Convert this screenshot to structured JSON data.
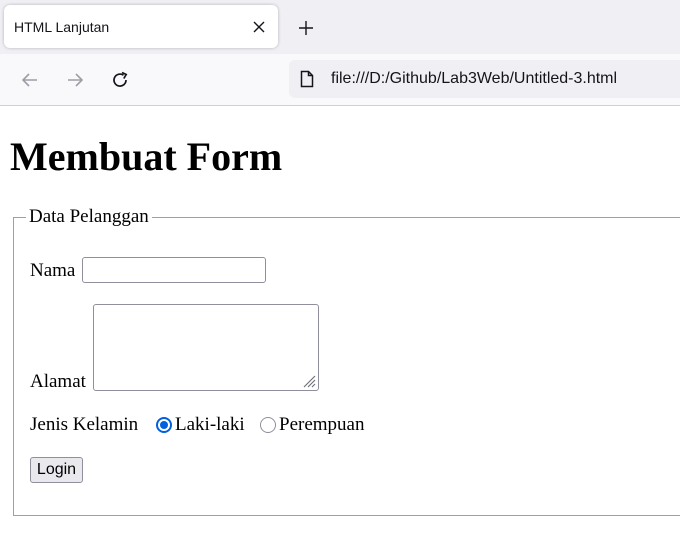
{
  "browser": {
    "tab_title": "HTML Lanjutan",
    "url": "file:///D:/Github/Lab3Web/Untitled-3.html"
  },
  "page": {
    "heading": "Membuat Form",
    "fieldset_legend": "Data Pelanggan",
    "nama_label": "Nama",
    "nama_value": "",
    "alamat_label": "Alamat",
    "alamat_value": "",
    "gender_label": "Jenis Kelamin",
    "gender_options": [
      "Laki-laki",
      "Perempuan"
    ],
    "gender_selected": "Laki-laki",
    "submit_label": "Login"
  },
  "colors": {
    "accent": "#0060df",
    "tabbar": "#f0f0f4",
    "navbar": "#f9f9fb"
  }
}
